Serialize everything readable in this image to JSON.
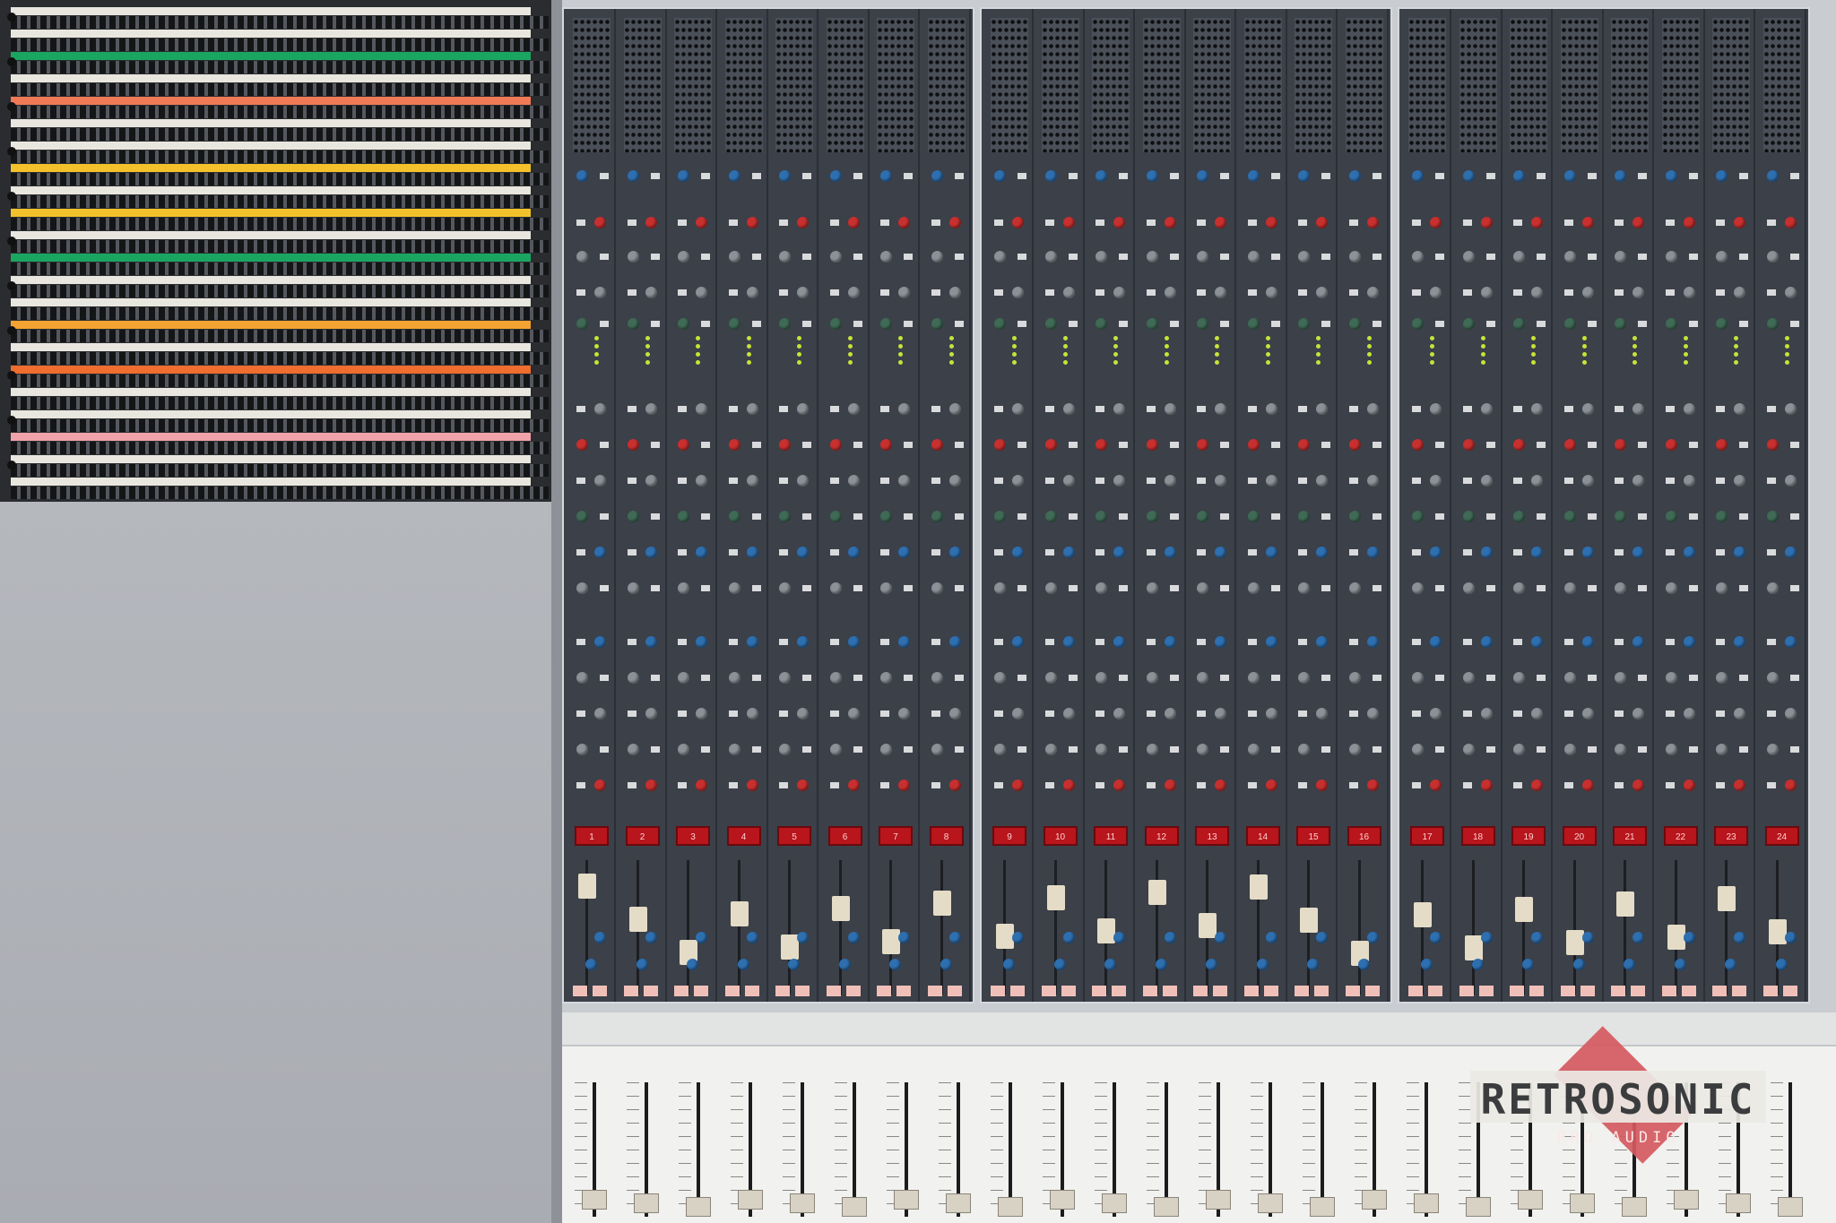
{
  "scene": "analog-mixing-console",
  "channel_numbers": [
    "1",
    "2",
    "3",
    "4",
    "5",
    "6",
    "7",
    "8",
    "9",
    "10",
    "11",
    "12",
    "13",
    "14",
    "15",
    "16",
    "17",
    "18",
    "19",
    "20",
    "21",
    "22",
    "23",
    "24"
  ],
  "patchbay_label_colors": [
    "#e8e6de",
    "#e8e6de",
    "#1aa661",
    "#e8e6de",
    "#f07a55",
    "#e8e6de",
    "#e8e6de",
    "#f2c12b",
    "#e8e6de",
    "#f2c12b",
    "#e8e6de",
    "#1aa661",
    "#e8e6de",
    "#e8e6de",
    "#f2a331",
    "#e8e6de",
    "#ee6d2f",
    "#e8e6de",
    "#e8e6de",
    "#f0a2a8",
    "#e8e6de",
    "#e8e6de"
  ],
  "colors": {
    "panel": "#3b4049",
    "knob_red": "#c7302f",
    "knob_blue": "#2e6fb0",
    "channel_button": "#b8151c",
    "fader_cap": "#d8d2c4"
  },
  "watermark": {
    "name": "RETROSONIC",
    "subtitle": "PRO AUDIO"
  }
}
